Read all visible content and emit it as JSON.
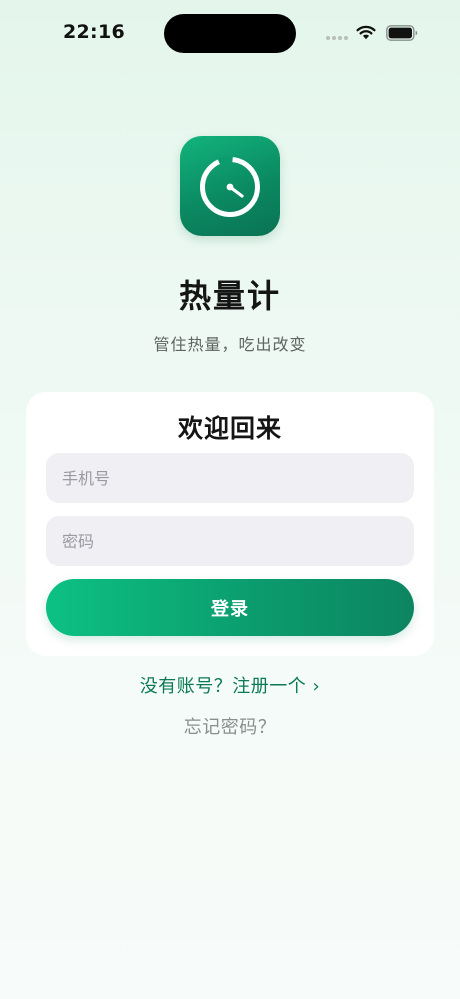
{
  "status_bar": {
    "time": "22:16",
    "wifi_icon": "wifi-icon",
    "battery_icon": "battery-icon"
  },
  "app": {
    "icon": "gauge-icon",
    "name": "热量计",
    "tagline": "管住热量，吃出改变",
    "accent_color": "#0b9a6c"
  },
  "login": {
    "title": "欢迎回来",
    "phone_placeholder": "手机号",
    "phone_value": "",
    "password_placeholder": "密码",
    "password_value": "",
    "submit_label": "登录"
  },
  "links": {
    "register": "没有账号？注册一个 ›",
    "forgot_password": "忘记密码？"
  }
}
